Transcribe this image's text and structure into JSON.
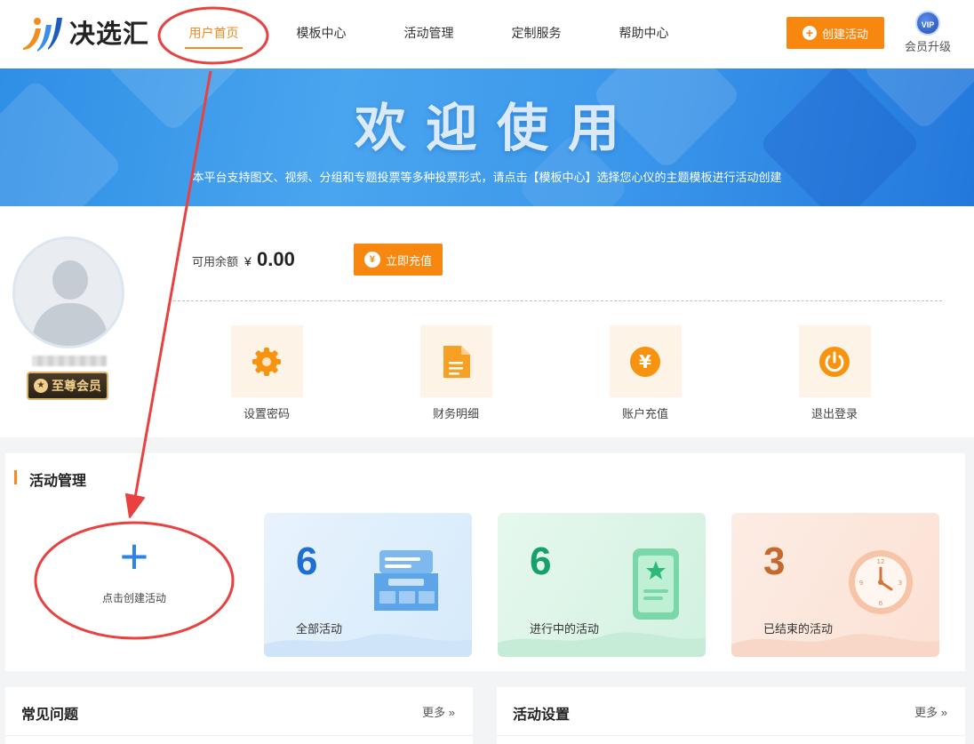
{
  "brand": {
    "name": "决选汇"
  },
  "nav": {
    "items": [
      {
        "label": "用户首页",
        "active": true
      },
      {
        "label": "模板中心"
      },
      {
        "label": "活动管理"
      },
      {
        "label": "定制服务"
      },
      {
        "label": "帮助中心"
      }
    ],
    "create_button": "创建活动",
    "vip_badge": "VIP",
    "vip_label": "会员升级"
  },
  "banner": {
    "title": "欢迎使用",
    "subtitle": "本平台支持图文、视频、分组和专题投票等多种投票形式，请点击【模板中心】选择您心仪的主题模板进行活动创建"
  },
  "account": {
    "member_level": "至尊会员",
    "balance_label": "可用余额",
    "currency": "¥",
    "balance": "0.00",
    "recharge_button": "立即充值",
    "quick_links": [
      {
        "label": "设置密码",
        "icon": "gear-icon"
      },
      {
        "label": "财务明细",
        "icon": "document-icon"
      },
      {
        "label": "账户充值",
        "icon": "yen-icon"
      },
      {
        "label": "退出登录",
        "icon": "power-icon"
      }
    ]
  },
  "activity": {
    "title": "活动管理",
    "create_label": "点击创建活动",
    "stats": [
      {
        "count": "6",
        "label": "全部活动",
        "color": "#1d6fd1"
      },
      {
        "count": "6",
        "label": "进行中的活动",
        "color": "#16a06b"
      },
      {
        "count": "3",
        "label": "已结束的活动",
        "color": "#c46a2e"
      }
    ]
  },
  "panels": {
    "faq": {
      "title": "常见问题",
      "more": "更多 »"
    },
    "settings": {
      "title": "活动设置",
      "more": "更多 »"
    }
  },
  "colors": {
    "accent": "#f7870f",
    "annotation": "#e8413f",
    "primary": "#2f82e6"
  }
}
